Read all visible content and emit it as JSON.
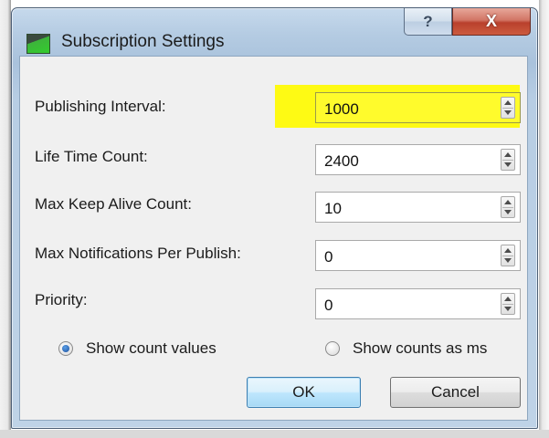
{
  "window": {
    "title": "Subscription Settings",
    "help_label": "?",
    "close_label": "X"
  },
  "fields": [
    {
      "label": "Publishing Interval:",
      "value": "1000"
    },
    {
      "label": "Life Time Count:",
      "value": "2400"
    },
    {
      "label": "Max Keep Alive Count:",
      "value": "10"
    },
    {
      "label": "Max Notifications Per Publish:",
      "value": "0"
    },
    {
      "label": "Priority:",
      "value": "0"
    }
  ],
  "options": {
    "show_count_values": "Show count values",
    "show_counts_as_ms": "Show counts as ms"
  },
  "buttons": {
    "ok": "OK",
    "cancel": "Cancel"
  },
  "colors": {
    "highlight": "#fefa14",
    "close_button": "#c8513a",
    "app_icon_green": "#33cc2e"
  }
}
